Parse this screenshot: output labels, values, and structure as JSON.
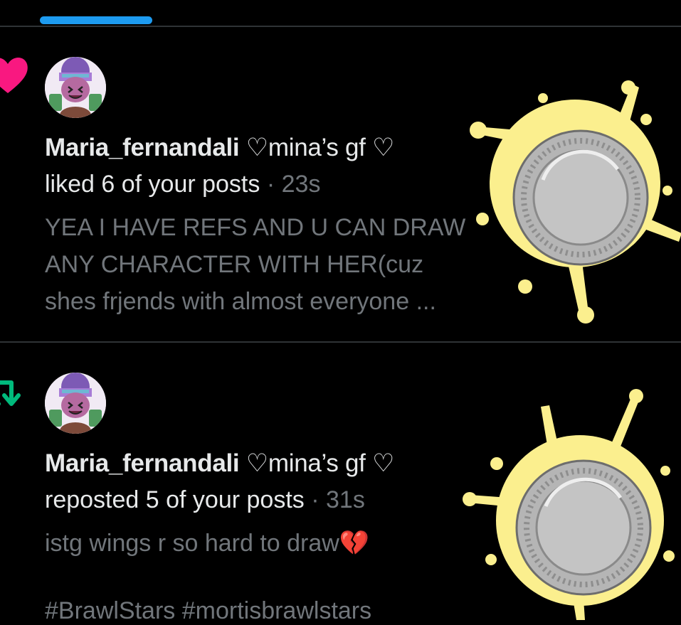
{
  "tabs": {
    "active_indicator_color": "#1d9bf0"
  },
  "notifications": [
    {
      "type": "like",
      "type_icon": "heart-icon",
      "icon_color": "#f91880",
      "name": "Maria_fernandali",
      "name_suffix": "♡mina’s gf ♡",
      "action": "liked 6 of your posts",
      "separator": "·",
      "time": "23s",
      "text_lines": [
        "YEA I HAVE REFS AND U CAN DRAW",
        "ANY CHARACTER WITH HER(cuz",
        "shes frjends with almost everyone ..."
      ]
    },
    {
      "type": "repost",
      "type_icon": "repost-icon",
      "icon_color": "#00ba7c",
      "name": "Maria_fernandali",
      "name_suffix": "♡mina’s gf ♡",
      "action": "reposted 5 of your posts",
      "separator": "·",
      "time": "31s",
      "text_lines": [
        "istg wings r so hard to draw💔"
      ],
      "hashtags": "#BrawlStars #mortisbrawlstars"
    }
  ]
}
